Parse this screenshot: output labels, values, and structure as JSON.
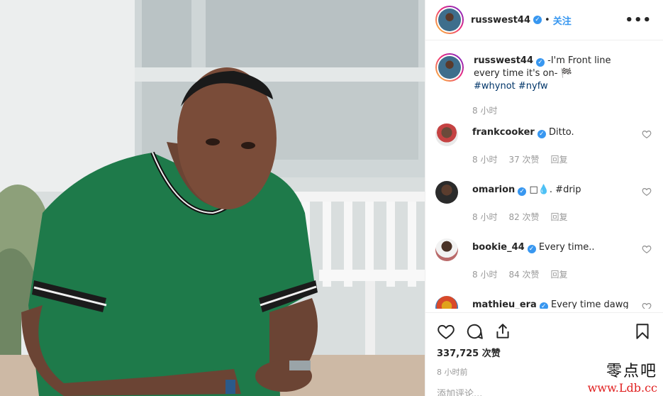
{
  "post": {
    "username": "russwest44",
    "follow_label": "关注",
    "separator": "•",
    "more_label": "•••"
  },
  "caption": {
    "username": "russwest44",
    "text": "-I'm Front line every time it's on- 🏁",
    "hashtags": "#whynot #nyfw",
    "time": "8 小时"
  },
  "comments": [
    {
      "username": "frankcooker",
      "text": "Ditto.",
      "time": "8 小时",
      "likes": "37 次赞",
      "reply": "回复"
    },
    {
      "username": "omarion",
      "text": "□💧. #drip",
      "time": "8 小时",
      "likes": "82 次赞",
      "reply": "回复"
    },
    {
      "username": "bookie_44",
      "text": "Every time..",
      "time": "8 小时",
      "likes": "84 次赞",
      "reply": "回复"
    },
    {
      "username": "mathieu_era",
      "text": "Every time dawg"
    }
  ],
  "stats": {
    "likes": "337,725 次赞",
    "time": "8 小时前"
  },
  "add_comment_placeholder": "添加评论...",
  "watermark": {
    "line1": "零点吧",
    "line2": "www.Ldb.cc"
  },
  "colors": {
    "accent": "#3897f0",
    "shirt": "#1e7a4a",
    "text": "#262626",
    "muted": "#999999"
  },
  "icons": [
    "heart-icon",
    "comment-icon",
    "share-icon",
    "bookmark-icon",
    "verified-badge-icon",
    "more-options-icon"
  ]
}
